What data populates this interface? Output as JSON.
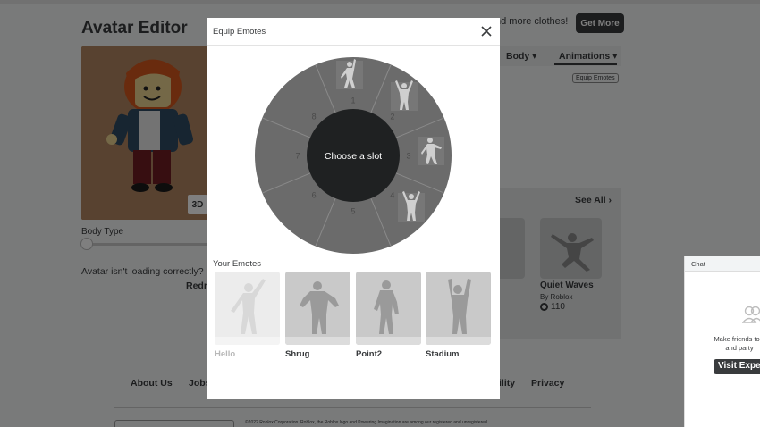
{
  "background": {
    "page_title": "Avatar Editor",
    "banner_text": "nd more clothes!",
    "get_more_label": "Get More",
    "btn_3d": "3D",
    "body_type_label": "Body Type",
    "body_type_value": 0,
    "loading_text": "Avatar isn't loading correctly?",
    "redraw_label": "Redr",
    "tabs": {
      "body": "Body ▾",
      "animations": "Animations ▾"
    },
    "equip_emotes_small": "Equip Emotes",
    "see_all": "See All ›",
    "item": {
      "name": "Quiet Waves",
      "by": "By Roblox",
      "price": "110"
    },
    "footer": {
      "about": "About Us",
      "jobs": "Jobs",
      "ility": "ility",
      "privacy": "Privacy"
    },
    "copyright": "©2022 Roblox Corporation. Roblox, the Roblox logo and Powering Imagination are among our registered and unregistered"
  },
  "chat": {
    "title": "Chat",
    "text_line1": "Make friends to s",
    "text_line2": "and party",
    "button_label": "Visit Exper"
  },
  "modal": {
    "title": "Equip Emotes",
    "center_label": "Choose a slot",
    "slots": [
      "1",
      "2",
      "3",
      "4",
      "5",
      "6",
      "7",
      "8"
    ],
    "your_emotes_label": "Your Emotes",
    "emotes": [
      {
        "name": "Hello",
        "dim": true
      },
      {
        "name": "Shrug",
        "dim": false
      },
      {
        "name": "Point2",
        "dim": false
      },
      {
        "name": "Stadium",
        "dim": false
      }
    ]
  },
  "colors": {
    "wheel_outer": "#6b6b6b",
    "wheel_center": "#1f2122",
    "slot_number": "#4a4a4a",
    "tile_bg": "#c9c9c9",
    "tile_strip": "#dcdcdc",
    "dark_button": "#393b3d"
  }
}
